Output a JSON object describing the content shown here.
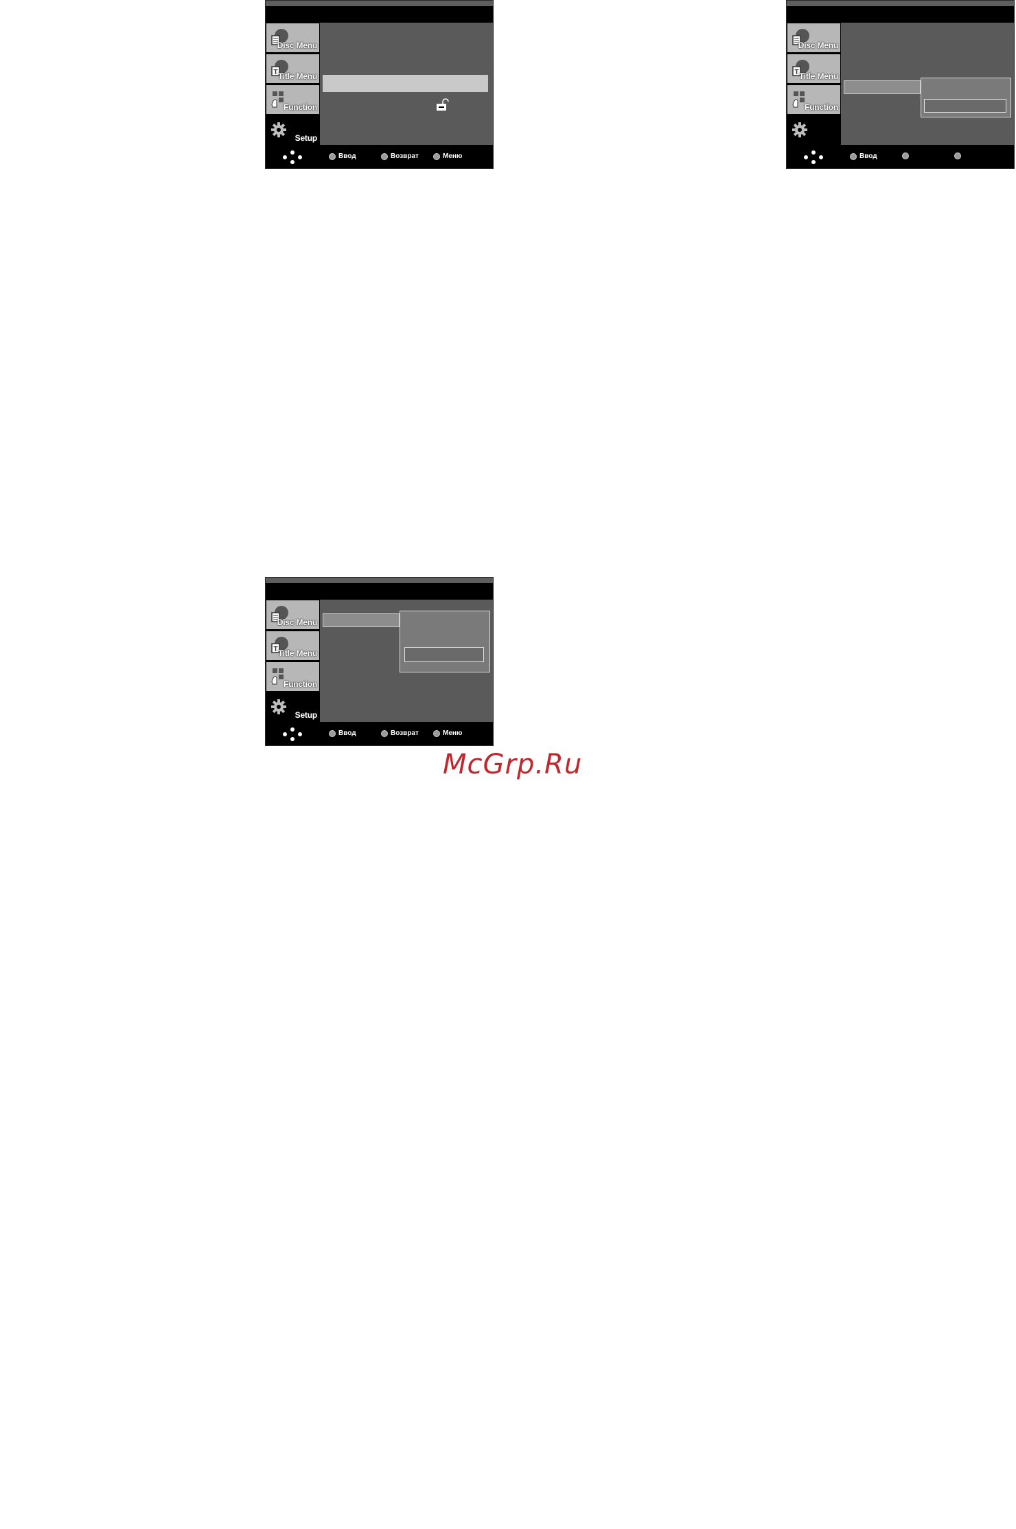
{
  "screens": [
    {
      "sidebar": {
        "items": [
          {
            "label": "Disc Menu",
            "icon": "disc-menu-icon"
          },
          {
            "label": "Title Menu",
            "icon": "title-menu-icon"
          },
          {
            "label": "Function",
            "icon": "function-icon"
          },
          {
            "label": "Setup",
            "icon": "gear-icon"
          }
        ]
      },
      "footer": {
        "enter_label": "Ввод",
        "return_label": "Возврат",
        "menu_label": "Меню"
      }
    },
    {
      "sidebar": {
        "items": [
          {
            "label": "Disc Menu",
            "icon": "disc-menu-icon"
          },
          {
            "label": "Title Menu",
            "icon": "title-menu-icon"
          },
          {
            "label": "Function",
            "icon": "function-icon"
          },
          {
            "label": "",
            "icon": "gear-icon"
          }
        ]
      },
      "footer": {
        "enter_label": "Ввод",
        "return_label": "",
        "menu_label": ""
      }
    },
    {
      "sidebar": {
        "items": [
          {
            "label": "Disc Menu",
            "icon": "disc-menu-icon"
          },
          {
            "label": "Title Menu",
            "icon": "title-menu-icon"
          },
          {
            "label": "Function",
            "icon": "function-icon"
          },
          {
            "label": "Setup",
            "icon": "gear-icon"
          }
        ]
      },
      "footer": {
        "enter_label": "Ввод",
        "return_label": "Возврат",
        "menu_label": "Меню"
      }
    }
  ],
  "watermark": "McGrp.Ru",
  "colors": {
    "menu_bg": "#5a5a5a",
    "sidebar_item": "#b7b7b7",
    "watermark": "#c0282e"
  }
}
